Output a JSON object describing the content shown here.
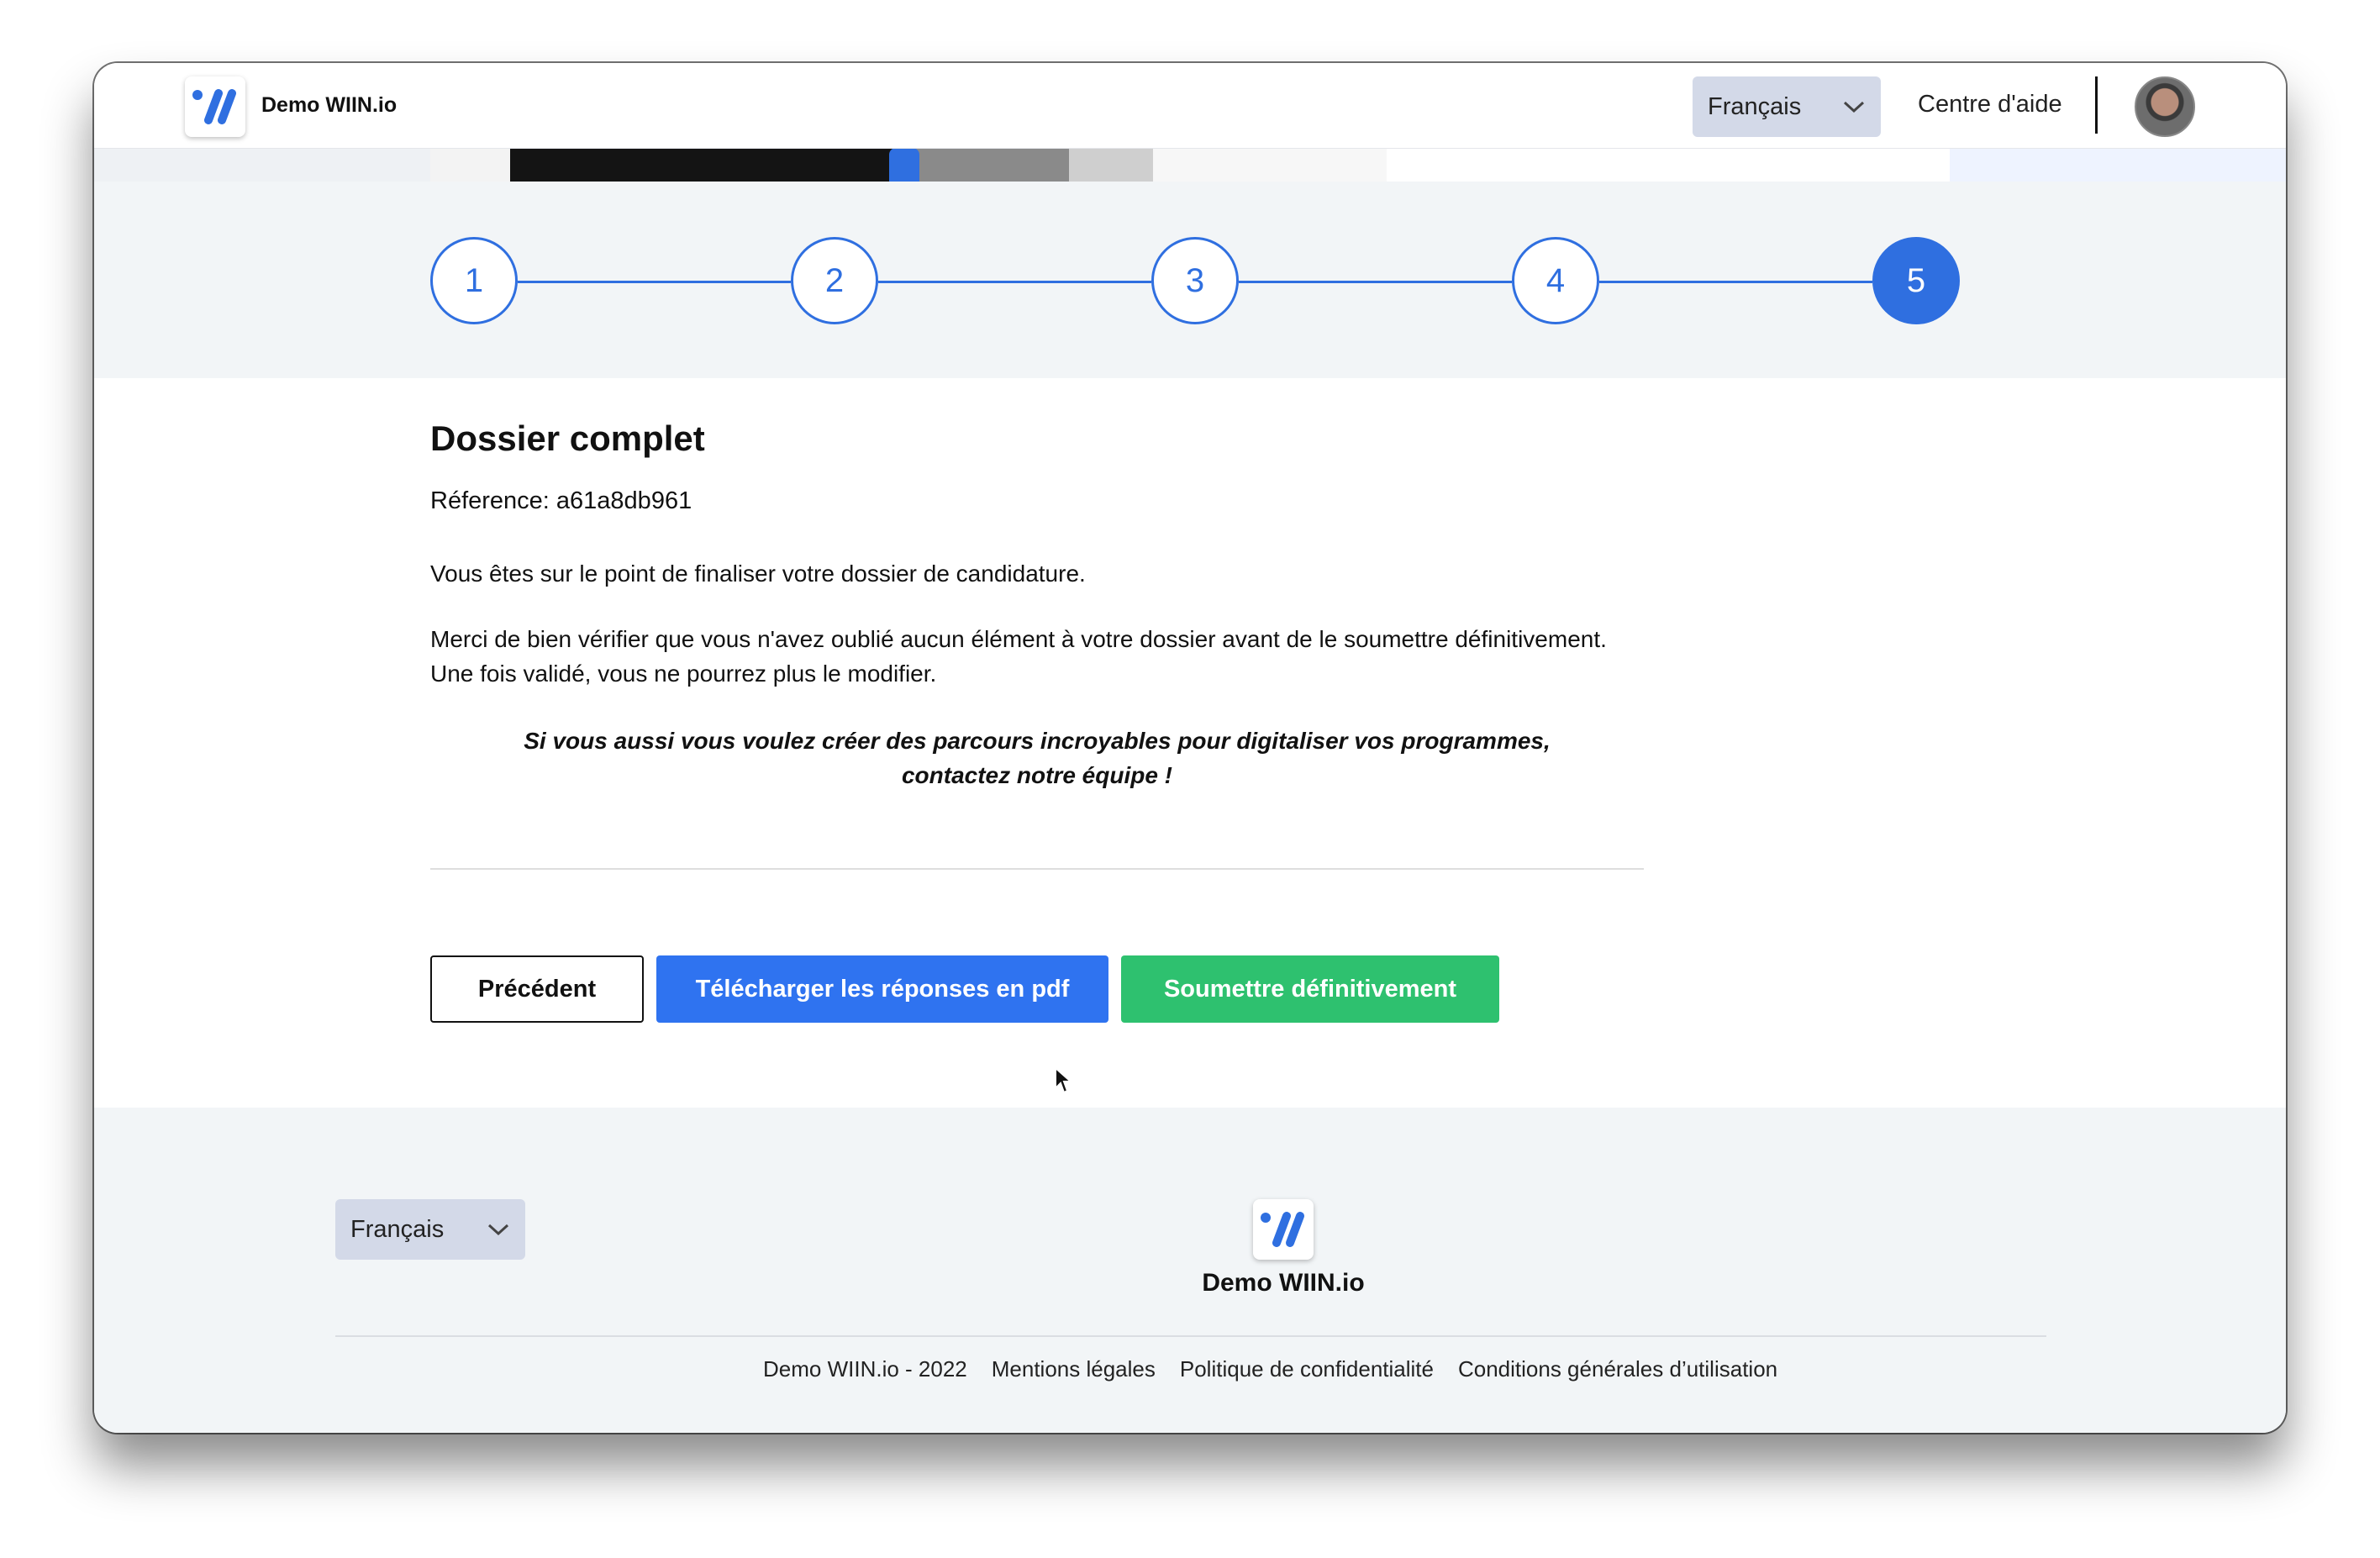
{
  "header": {
    "brand": "Demo WIIN.io",
    "language": "Français",
    "help_link": "Centre d'aide"
  },
  "stepper": {
    "steps": [
      "1",
      "2",
      "3",
      "4",
      "5"
    ],
    "current_step": 5
  },
  "content": {
    "title": "Dossier complet",
    "reference": "Réference: a61a8db961",
    "paragraph1": "Vous êtes sur le point de finaliser votre dossier de candidature.",
    "paragraph2_line1": "Merci de bien vérifier que vous n'avez oublié aucun élément à votre dossier avant de le soumettre définitivement.",
    "paragraph2_line2": "Une fois validé, vous ne pourrez plus le modifier.",
    "cta_line1": "Si vous aussi vous voulez créer des parcours incroyables pour digitaliser vos programmes,",
    "cta_line2": "contactez notre équipe !"
  },
  "actions": {
    "previous": "Précédent",
    "download_pdf": "Télécharger les réponses en pdf",
    "submit": "Soumettre définitivement"
  },
  "footer": {
    "language": "Français",
    "brand": "Demo WIIN.io",
    "links": [
      "Demo WIIN.io - 2022",
      "Mentions légales",
      "Politique de confidentialité",
      "Conditions générales d’utilisation"
    ]
  },
  "colors": {
    "primary": "#2f73f0",
    "success": "#2ec16f",
    "select_bg": "#d3d9e8",
    "section_bg": "#f2f5f7"
  }
}
